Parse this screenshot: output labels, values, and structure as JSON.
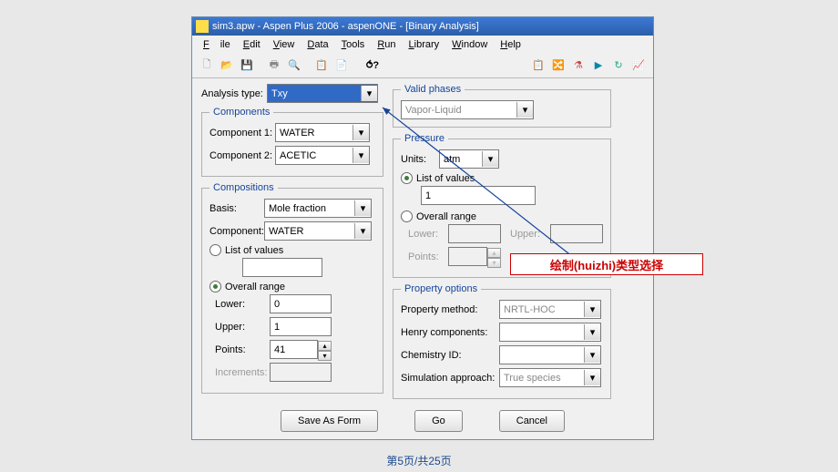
{
  "window": {
    "title": "sim3.apw - Aspen Plus 2006 - aspenONE - [Binary Analysis]"
  },
  "menu": {
    "file": "File",
    "edit": "Edit",
    "view": "View",
    "data": "Data",
    "tools": "Tools",
    "run": "Run",
    "library": "Library",
    "window": "Window",
    "help": "Help"
  },
  "analysis": {
    "label": "Analysis type:",
    "value": "Txy"
  },
  "components": {
    "legend": "Components",
    "c1_label": "Component 1:",
    "c1_value": "WATER",
    "c2_label": "Component 2:",
    "c2_value": "ACETIC"
  },
  "compositions": {
    "legend": "Compositions",
    "basis_label": "Basis:",
    "basis_value": "Mole fraction",
    "comp_label": "Component:",
    "comp_value": "WATER",
    "list_label": "List of values",
    "list_value": "",
    "overall_label": "Overall range",
    "lower_label": "Lower:",
    "lower_value": "0",
    "upper_label": "Upper:",
    "upper_value": "1",
    "points_label": "Points:",
    "points_value": "41",
    "incr_label": "Increments:"
  },
  "validphases": {
    "legend": "Valid phases",
    "value": "Vapor-Liquid"
  },
  "pressure": {
    "legend": "Pressure",
    "units_label": "Units:",
    "units_value": "atm",
    "list_label": "List of values",
    "list_value": "1",
    "overall_label": "Overall range",
    "lower_label": "Lower:",
    "upper_label": "Upper:",
    "points_label": "Points:"
  },
  "propopts": {
    "legend": "Property options",
    "method_label": "Property method:",
    "method_value": "NRTL-HOC",
    "henry_label": "Henry components:",
    "chem_label": "Chemistry ID:",
    "sim_label": "Simulation approach:",
    "sim_value": "True species"
  },
  "buttons": {
    "save": "Save As Form",
    "go": "Go",
    "cancel": "Cancel"
  },
  "callout": "绘制(huizhi)类型选择",
  "footer": "第5页/共25页"
}
